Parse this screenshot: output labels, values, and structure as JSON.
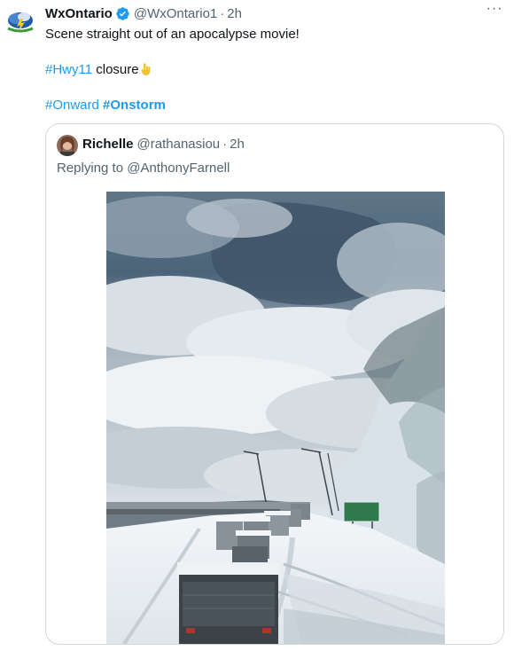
{
  "tweet": {
    "display_name": "WxOntario",
    "handle": "@WxOntario1",
    "separator": "·",
    "time": "2h",
    "more_label": "···",
    "text_line1": "Scene straight out of an apocalypse movie!",
    "hashtag_hwy": "#Hwy11",
    "closure_word": " closure",
    "hashtag_onward": "#Onward",
    "hashtag_onstorm": "#Onstorm",
    "verified_icon": "verified-badge-icon",
    "emoji_icon": "pointing-down-emoji"
  },
  "quote": {
    "display_name": "Richelle",
    "handle": "@rathanasiou",
    "separator": "·",
    "time": "2h",
    "replying_to": "Replying to @AnthonyFarnell"
  },
  "colors": {
    "link": "#1d9bf0",
    "secondary_text": "#536471",
    "border": "#cfd9de",
    "verified": "#1d9bf0"
  }
}
